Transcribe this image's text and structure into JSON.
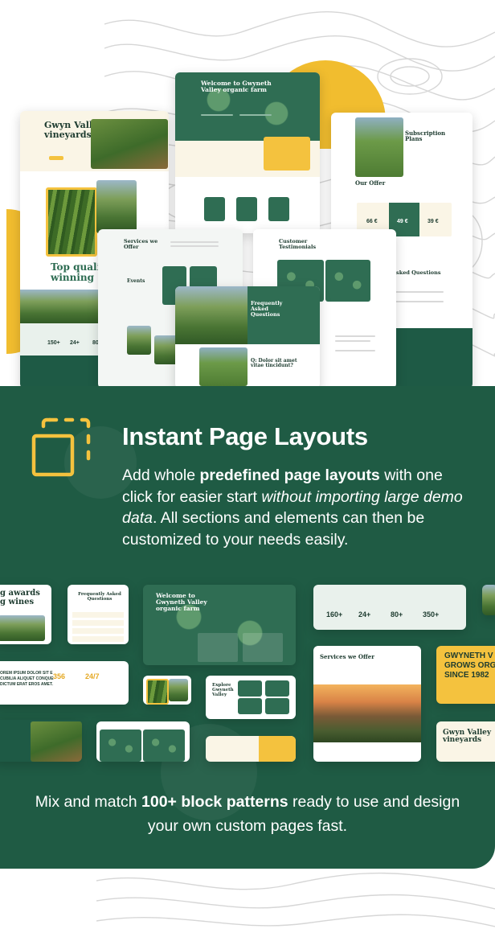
{
  "feature": {
    "title": "Instant Page Layouts",
    "desc_lead": "Add whole ",
    "desc_bold": "predefined page layouts",
    "desc_mid": " with one click for easier start ",
    "desc_italic": "without importing large demo data",
    "desc_tail": ". All sections and elements can then be customized to your needs easily.",
    "icon": "dashed-square-layout-icon"
  },
  "footer": {
    "lead": "Mix and match ",
    "bold": "100+ block patterns",
    "tail": " ready to use and design your own custom pages fast."
  },
  "previews": {
    "vineyards": "Gwyn Valley vineyards",
    "welcome": "Welcome to Gwyneth Valley organic farm",
    "subscription": "Subscription Plans",
    "our_offer": "Our Offer",
    "services": "Services we Offer",
    "events": "Events",
    "testimonials": "Customer Testimonials",
    "faq": "Frequently Asked Questions",
    "faq_q": "Q: Dolor sit amet vitae tincidunt?",
    "top_quality": "Top quality winning",
    "asked_q": "Asked Questions",
    "price_1": "66 €",
    "price_2": "49 €",
    "price_3": "39 €",
    "stat_a": "150+",
    "stat_b": "24+",
    "stat_c": "80+"
  },
  "patterns": {
    "awards": "g awards g wines",
    "faq": "Frequently Asked Questions",
    "welcome": "Welcome to Gwyneth Valley organic farm",
    "explore": "Explore Gwyneth Valley",
    "services": "Services we Offer",
    "vineyards": "Gwyn Valley vineyards",
    "grows": "GWYNETH V GROWS ORG SINCE 1982",
    "grows_1": "GWYNETH V",
    "grows_2": "GROWS ORG",
    "grows_3": "SINCE 1982",
    "lorem": "OREM IPSUM DOLOR SIT E CUBILIA ALIQUET CONQUE DICTUM ERAT EROS AMET.",
    "stats": [
      "160+",
      "24+",
      "80+",
      "350+"
    ],
    "nums": [
      "356",
      "24/7"
    ]
  },
  "colors": {
    "primary_green": "#1f5b44",
    "accent_yellow": "#f4c23e",
    "cream": "#faf5e6"
  }
}
